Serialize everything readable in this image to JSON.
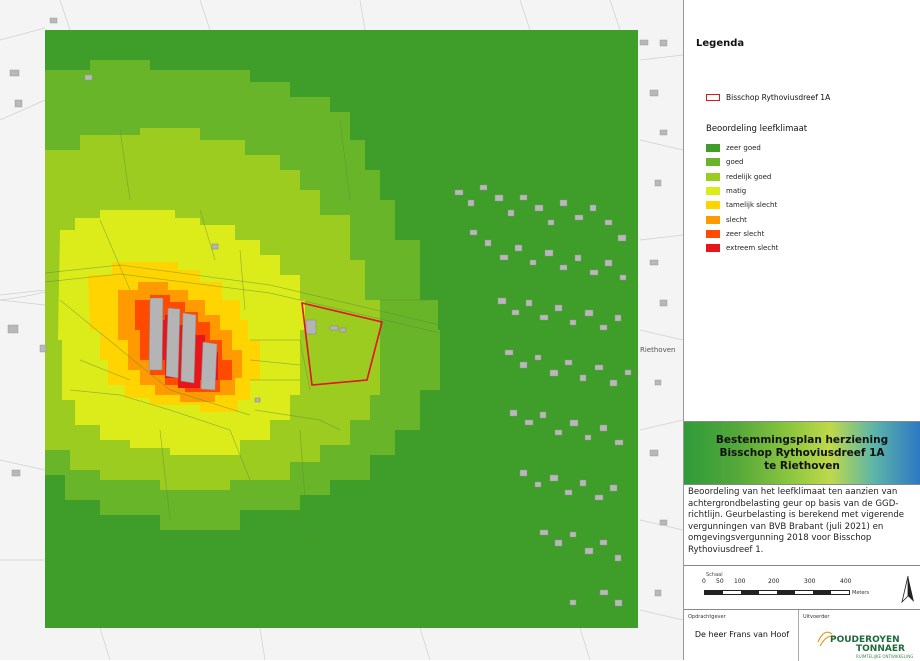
{
  "legend": {
    "title": "Legenda",
    "boundary_label": "Bisschop Rythoviusdreef 1A",
    "subtitle": "Beoordeling leefklimaat",
    "items": [
      {
        "label": "zeer goed",
        "color": "#3f9e2a"
      },
      {
        "label": "goed",
        "color": "#69b52a"
      },
      {
        "label": "redelijk goed",
        "color": "#9ccc1f"
      },
      {
        "label": "matig",
        "color": "#dcec1a"
      },
      {
        "label": "tamelijk slecht",
        "color": "#ffd400"
      },
      {
        "label": "slecht",
        "color": "#ff9b00"
      },
      {
        "label": "zeer slecht",
        "color": "#ff4a00"
      },
      {
        "label": "extreem slecht",
        "color": "#e8151c"
      }
    ]
  },
  "title_block": {
    "line1": "Bestemmingsplan herziening",
    "line2": "Bisschop Rythoviusdreef 1A",
    "line3": "te Riethoven"
  },
  "description": "Beoordeling van het leefklimaat ten aanzien van achtergrondbelasting geur op basis van de GGD-richtlijn. Geurbelasting is berekend met vigerende vergunningen van BVB Brabant (juli 2021) en omgevingsvergunning 2018 voor Bisschop Rythoviusdreef 1.",
  "scale": {
    "label": "Schaal",
    "ticks": [
      "0",
      "50",
      "100",
      "200",
      "300",
      "400"
    ],
    "units": "Meters"
  },
  "client": {
    "label": "Opdrachtgever",
    "name": "De heer Frans van Hoof"
  },
  "author": {
    "label": "Uitvoerder",
    "logo_text_1": "POUDEROYEN",
    "logo_text_2": "TONNAER",
    "logo_text_3": "RUIMTELIJKE ONTWIKKELING"
  },
  "map": {
    "street_label": "Riethoven"
  },
  "colors": {
    "building": "#b8b8b8",
    "boundary": "#e0141e"
  }
}
